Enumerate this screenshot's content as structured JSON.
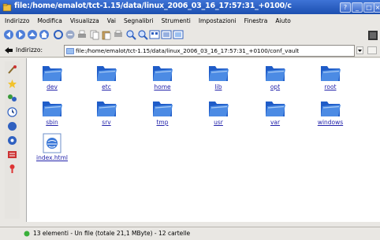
{
  "window": {
    "title": "file:/home/emalot/tct-1.15/data/linux_2006_03_16_17:57:31_+0100/c"
  },
  "menubar": {
    "items": [
      "Indirizzo",
      "Modifica",
      "Visualizza",
      "Vai",
      "Segnalibri",
      "Strumenti",
      "Impostazioni",
      "Finestra",
      "Aiuto"
    ]
  },
  "location": {
    "label": "Indirizzo:",
    "url": "file:/home/emalot/tct-1.15/data/linux_2006_03_16_17:57:31_+0100/conf_vault"
  },
  "files": [
    {
      "name": "dev",
      "type": "folder"
    },
    {
      "name": "etc",
      "type": "folder"
    },
    {
      "name": "home",
      "type": "folder"
    },
    {
      "name": "lib",
      "type": "folder"
    },
    {
      "name": "opt",
      "type": "folder"
    },
    {
      "name": "root",
      "type": "folder"
    },
    {
      "name": "sbin",
      "type": "folder"
    },
    {
      "name": "srv",
      "type": "folder"
    },
    {
      "name": "tmp",
      "type": "folder"
    },
    {
      "name": "usr",
      "type": "folder"
    },
    {
      "name": "var",
      "type": "folder"
    },
    {
      "name": "windows",
      "type": "folder"
    },
    {
      "name": "index.html",
      "type": "html-file"
    }
  ],
  "status": {
    "text": "13 elementi - Un file (totale 21,1 MByte) - 12 cartelle"
  },
  "colors": {
    "titlebar": "#2a5cc0",
    "folder": "#3b78d8",
    "link": "#2222aa"
  }
}
